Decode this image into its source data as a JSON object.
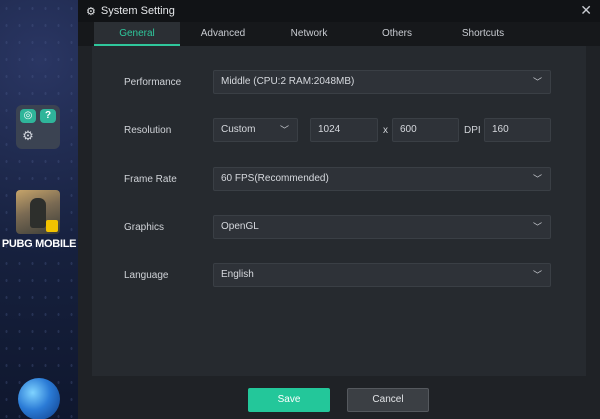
{
  "desktop": {
    "pubg_label": "PUBG MOBILE",
    "folder_icons": [
      "app-icon-green",
      "help-icon",
      "gear-icon"
    ]
  },
  "window": {
    "title": "System Setting",
    "close_glyph": "✕"
  },
  "tabs": [
    {
      "label": "General",
      "active": true
    },
    {
      "label": "Advanced",
      "active": false
    },
    {
      "label": "Network",
      "active": false
    },
    {
      "label": "Others",
      "active": false
    },
    {
      "label": "Shortcuts",
      "active": false
    }
  ],
  "settings": {
    "performance": {
      "label": "Performance",
      "value": "Middle (CPU:2 RAM:2048MB)"
    },
    "resolution": {
      "label": "Resolution",
      "preset": "Custom",
      "width": "1024",
      "separator": "x",
      "height": "600",
      "dpi_label": "DPI",
      "dpi": "160"
    },
    "frame_rate": {
      "label": "Frame Rate",
      "value": "60 FPS(Recommended)"
    },
    "graphics": {
      "label": "Graphics",
      "value": "OpenGL"
    },
    "language": {
      "label": "Language",
      "value": "English"
    }
  },
  "footer": {
    "save_label": "Save",
    "cancel_label": "Cancel"
  },
  "colors": {
    "accent": "#2fc79c",
    "save_button": "#23c79a",
    "panel": "#262a2f",
    "titlebar": "#111316"
  }
}
